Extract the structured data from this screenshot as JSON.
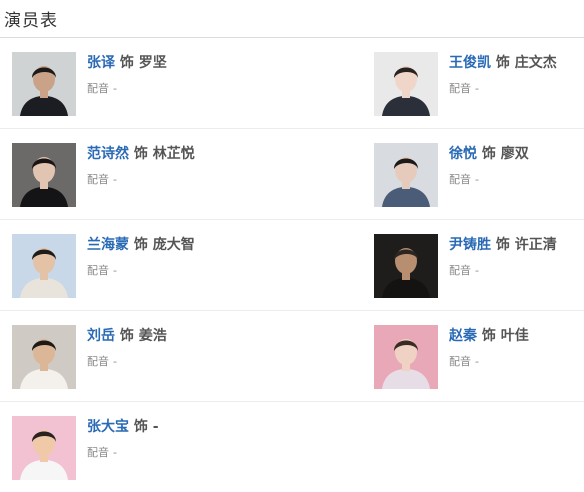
{
  "section": {
    "title": "演员表"
  },
  "cast": [
    {
      "actor": "张译",
      "plays": "饰",
      "role": "罗坚",
      "dub_label": "配音",
      "dub_value": "-",
      "photo": {
        "bg": "#cfd3d3",
        "skin": "#caa288",
        "hair": "#1d1b1a",
        "cloth": "#1b1d22"
      }
    },
    {
      "actor": "王俊凯",
      "plays": "饰",
      "role": "庄文杰",
      "dub_label": "配音",
      "dub_value": "-",
      "photo": {
        "bg": "#e9e9ea",
        "skin": "#efd6c8",
        "hair": "#2a2220",
        "cloth": "#2b2f39"
      }
    },
    {
      "actor": "范诗然",
      "plays": "饰",
      "role": "林芷悦",
      "dub_label": "配音",
      "dub_value": "-",
      "photo": {
        "bg": "#6c6a69",
        "skin": "#e2c4b3",
        "hair": "#1a1514",
        "cloth": "#141416"
      }
    },
    {
      "actor": "徐悦",
      "plays": "饰",
      "role": "廖双",
      "dub_label": "配音",
      "dub_value": "-",
      "photo": {
        "bg": "#d8dbe0",
        "skin": "#e6cbbd",
        "hair": "#1c1a19",
        "cloth": "#4b5c78"
      }
    },
    {
      "actor": "兰海蒙",
      "plays": "饰",
      "role": "庞大智",
      "dub_label": "配音",
      "dub_value": "-",
      "photo": {
        "bg": "#c8d8e8",
        "skin": "#e3c2a6",
        "hair": "#1f1b19",
        "cloth": "#e8e4dc"
      }
    },
    {
      "actor": "尹铸胜",
      "plays": "饰",
      "role": "许正清",
      "dub_label": "配音",
      "dub_value": "-",
      "photo": {
        "bg": "#1e1d1b",
        "skin": "#b78e70",
        "hair": "#2b2622",
        "cloth": "#141312"
      }
    },
    {
      "actor": "刘岳",
      "plays": "饰",
      "role": "姜浩",
      "dub_label": "配音",
      "dub_value": "-",
      "photo": {
        "bg": "#cfcac4",
        "skin": "#dcb797",
        "hair": "#1d1a18",
        "cloth": "#f4f1ec"
      }
    },
    {
      "actor": "赵秦",
      "plays": "饰",
      "role": "叶佳",
      "dub_label": "配音",
      "dub_value": "-",
      "photo": {
        "bg": "#e9a8b8",
        "skin": "#f0d2c5",
        "hair": "#3a2a24",
        "cloth": "#e7dde6"
      }
    },
    {
      "actor": "张大宝",
      "plays": "饰",
      "role": "-",
      "dub_label": "配音",
      "dub_value": "-",
      "photo": {
        "bg": "#f3c2d2",
        "skin": "#f0c9a8",
        "hair": "#2a2220",
        "cloth": "#f6f6f6"
      }
    }
  ],
  "colors": {
    "link": "#2a6ab5",
    "muted": "#888888",
    "divider": "#ececec"
  }
}
